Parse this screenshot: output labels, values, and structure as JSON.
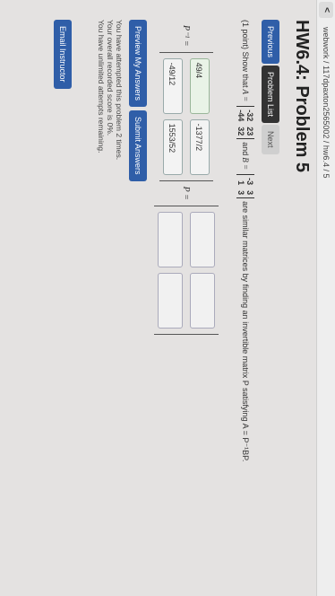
{
  "header": {
    "breadcrumb": "webwork / 117dpaxton2565002 / hw6.4 / 5",
    "title": "HW6.4: Problem 5"
  },
  "nav": {
    "previous": "Previous",
    "list": "Problem List",
    "next": "Next"
  },
  "problem": {
    "intro": "(1 point) Show that ",
    "a_label": "A =",
    "A": [
      "-32",
      "23",
      "-44",
      "32"
    ],
    "and": "and",
    "b_label": "B =",
    "B": [
      "-3",
      "3",
      "1",
      "3"
    ],
    "tail": "are similar matrices by finding an invertible matrix P satisfying A = P⁻¹BP."
  },
  "answers": {
    "p_inv_label": "P⁻¹ =",
    "p_inv": [
      "49/4",
      "-1377/2",
      "-49/12",
      "1553/52"
    ],
    "p_label": "P ="
  },
  "actions": {
    "preview": "Preview My Answers",
    "submit": "Submit Answers",
    "email": "Email Instructor"
  },
  "status": [
    "You have attempted this problem 2 times.",
    "Your overall recorded score is 0%.",
    "You have unlimited attempts remaining."
  ]
}
